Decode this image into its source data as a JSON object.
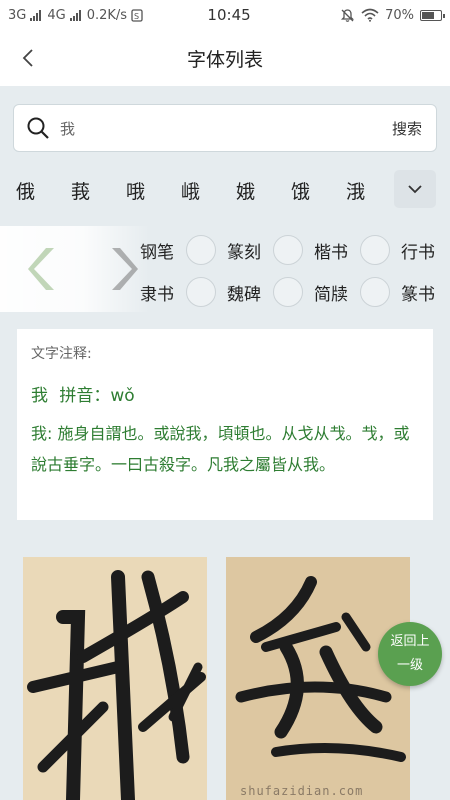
{
  "status_bar": {
    "network1": "3G",
    "network2": "4G",
    "speed": "0.2K/s",
    "time": "10:45",
    "battery": "70%",
    "battery_level": 0.7
  },
  "header": {
    "title": "字体列表"
  },
  "search": {
    "value": "我",
    "button_label": "搜索"
  },
  "related_chars": [
    "俄",
    "莪",
    "哦",
    "峨",
    "娥",
    "饿",
    "涐"
  ],
  "styles": {
    "row1": [
      "钢笔",
      "篆刻",
      "楷书",
      "行书"
    ],
    "row2": [
      "隶书",
      "魏碑",
      "简牍",
      "篆书"
    ]
  },
  "annotation": {
    "heading": "文字注释:",
    "char": "我",
    "pinyin": "拼音：wǒ",
    "definition": "我: 施身自謂也。或說我，頃頓也。从戈从𢦏。𢦏，或說古垂字。一曰古殺字。凡我之屬皆从我。"
  },
  "images": {
    "watermark": "shufazidian.com"
  },
  "return_button": {
    "line1": "返回上",
    "line2": "一级"
  }
}
